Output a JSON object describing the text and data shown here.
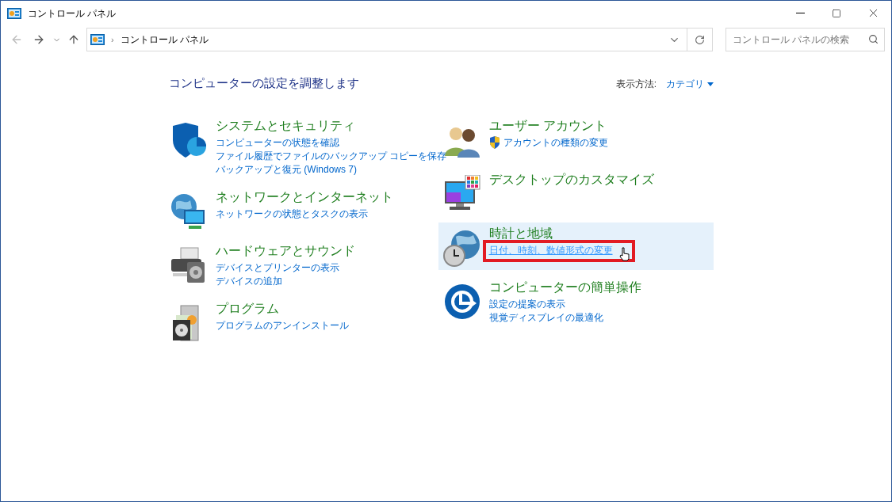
{
  "window": {
    "title": "コントロール パネル"
  },
  "nav": {
    "separator": "›",
    "breadcrumb": "コントロール パネル",
    "search": {
      "placeholder": "コントロール パネルの検索"
    }
  },
  "heading": "コンピューターの設定を調整します",
  "view_by": {
    "label": "表示方法:",
    "value": "カテゴリ"
  },
  "columns": [
    {
      "categories": [
        {
          "kind": "security",
          "title": "システムとセキュリティ",
          "highlighted": false,
          "links": [
            {
              "text": "コンピューターの状態を確認",
              "shield": false,
              "hovered": false,
              "annotated": false
            },
            {
              "text": "ファイル履歴でファイルのバックアップ コピーを保存",
              "shield": false,
              "hovered": false,
              "annotated": false
            },
            {
              "text": "バックアップと復元 (Windows 7)",
              "shield": false,
              "hovered": false,
              "annotated": false
            }
          ]
        },
        {
          "kind": "network",
          "title": "ネットワークとインターネット",
          "highlighted": false,
          "links": [
            {
              "text": "ネットワークの状態とタスクの表示",
              "shield": false,
              "hovered": false,
              "annotated": false
            }
          ]
        },
        {
          "kind": "hardware",
          "title": "ハードウェアとサウンド",
          "highlighted": false,
          "links": [
            {
              "text": "デバイスとプリンターの表示",
              "shield": false,
              "hovered": false,
              "annotated": false
            },
            {
              "text": "デバイスの追加",
              "shield": false,
              "hovered": false,
              "annotated": false
            }
          ]
        },
        {
          "kind": "programs",
          "title": "プログラム",
          "highlighted": false,
          "links": [
            {
              "text": "プログラムのアンインストール",
              "shield": false,
              "hovered": false,
              "annotated": false
            }
          ]
        }
      ]
    },
    {
      "categories": [
        {
          "kind": "users",
          "title": "ユーザー アカウント",
          "highlighted": false,
          "links": [
            {
              "text": "アカウントの種類の変更",
              "shield": true,
              "hovered": false,
              "annotated": false
            }
          ]
        },
        {
          "kind": "appearance",
          "title": "デスクトップのカスタマイズ",
          "highlighted": false
        },
        {
          "kind": "clock",
          "title": "時計と地域",
          "highlighted": true,
          "links": [
            {
              "text": "日付、時刻、数値形式の変更",
              "shield": false,
              "hovered": true,
              "annotated": true
            }
          ]
        },
        {
          "kind": "access",
          "title": "コンピューターの簡単操作",
          "highlighted": false,
          "links": [
            {
              "text": "設定の提案の表示",
              "shield": false,
              "hovered": false,
              "annotated": false
            },
            {
              "text": "視覚ディスプレイの最適化",
              "shield": false,
              "hovered": false,
              "annotated": false
            }
          ]
        }
      ]
    }
  ]
}
